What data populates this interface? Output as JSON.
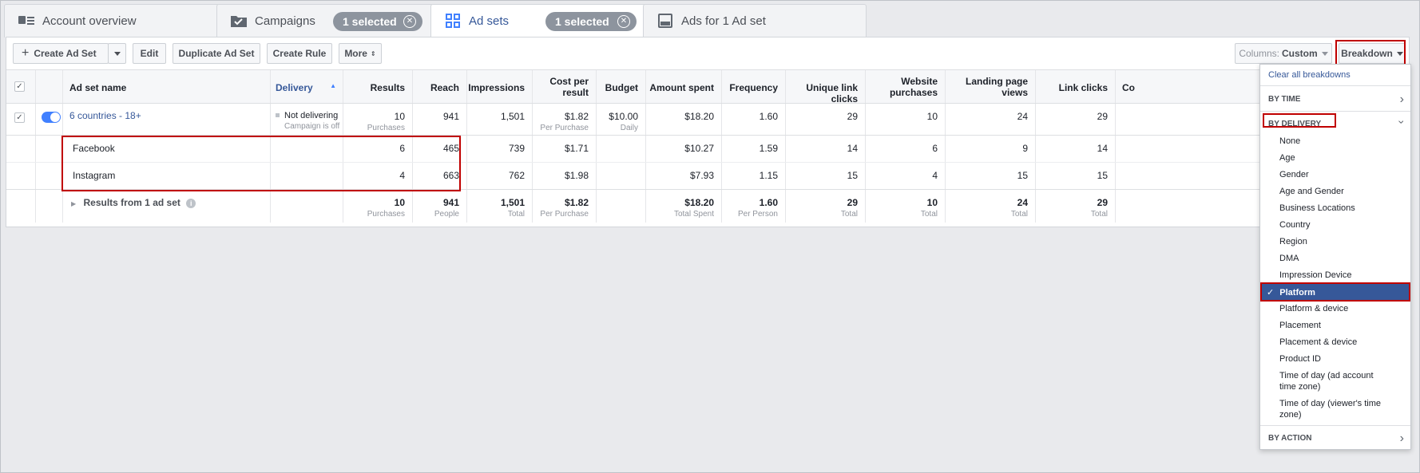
{
  "tabs": {
    "account_overview": "Account overview",
    "campaigns": "Campaigns",
    "campaigns_selected": "1 selected",
    "ad_sets": "Ad sets",
    "ad_sets_selected": "1 selected",
    "ads": "Ads for 1 Ad set"
  },
  "toolbar": {
    "create": "Create Ad Set",
    "edit": "Edit",
    "duplicate": "Duplicate Ad Set",
    "create_rule": "Create Rule",
    "more": "More",
    "columns_prefix": "Columns:",
    "columns_value": "Custom",
    "breakdown": "Breakdown"
  },
  "table": {
    "headers": {
      "name": "Ad set name",
      "delivery": "Delivery",
      "results": "Results",
      "reach": "Reach",
      "impressions": "Impressions",
      "cpr_l1": "Cost per",
      "cpr_l2": "result",
      "budget": "Budget",
      "amount": "Amount spent",
      "frequency": "Frequency",
      "ulc": "Unique link clicks",
      "wp_l1": "Website",
      "wp_l2": "purchases",
      "lpv_l1": "Landing page",
      "lpv_l2": "views",
      "lc": "Link clicks",
      "co": "Co"
    },
    "adset": {
      "name": "6 countries - 18+",
      "delivery": "Not delivering",
      "delivery_sub": "Campaign is off",
      "results": "10",
      "results_sub": "Purchases",
      "reach": "941",
      "impressions": "1,501",
      "cpr": "$1.82",
      "cpr_sub": "Per Purchase",
      "budget": "$10.00",
      "budget_sub": "Daily",
      "amount": "$18.20",
      "frequency": "1.60",
      "ulc": "29",
      "wp": "10",
      "lpv": "24",
      "lc": "29"
    },
    "breakdown_rows": [
      {
        "name": "Facebook",
        "results": "6",
        "reach": "465",
        "impressions": "739",
        "cpr": "$1.71",
        "amount": "$10.27",
        "frequency": "1.59",
        "ulc": "14",
        "wp": "6",
        "lpv": "9",
        "lc": "14"
      },
      {
        "name": "Instagram",
        "results": "4",
        "reach": "663",
        "impressions": "762",
        "cpr": "$1.98",
        "amount": "$7.93",
        "frequency": "1.15",
        "ulc": "15",
        "wp": "4",
        "lpv": "15",
        "lc": "15"
      }
    ],
    "totals": {
      "label": "Results from 1 ad set",
      "results": "10",
      "results_sub": "Purchases",
      "reach": "941",
      "reach_sub": "People",
      "impressions": "1,501",
      "impressions_sub": "Total",
      "cpr": "$1.82",
      "cpr_sub": "Per Purchase",
      "amount": "$18.20",
      "amount_sub": "Total Spent",
      "frequency": "1.60",
      "frequency_sub": "Per Person",
      "ulc": "29",
      "ulc_sub": "Total",
      "wp": "10",
      "wp_sub": "Total",
      "lpv": "24",
      "lpv_sub": "Total",
      "lc": "29",
      "lc_sub": "Total"
    }
  },
  "breakdown_menu": {
    "clear": "Clear all breakdowns",
    "by_time": "BY TIME",
    "by_delivery": "BY DELIVERY",
    "items": [
      "None",
      "Age",
      "Gender",
      "Age and Gender",
      "Business Locations",
      "Country",
      "Region",
      "DMA",
      "Impression Device"
    ],
    "selected": "Platform",
    "items_after": [
      "Platform & device",
      "Placement",
      "Placement & device",
      "Product ID"
    ],
    "tod_account_l1": "Time of day (ad account",
    "tod_account_l2": "time zone)",
    "tod_viewer_l1": "Time of day (viewer's time",
    "tod_viewer_l2": "zone)",
    "by_action": "BY ACTION"
  },
  "colors": {
    "link": "#365899",
    "accent": "#4080ff",
    "highlight": "#c00000",
    "selected_bg": "#365899"
  }
}
